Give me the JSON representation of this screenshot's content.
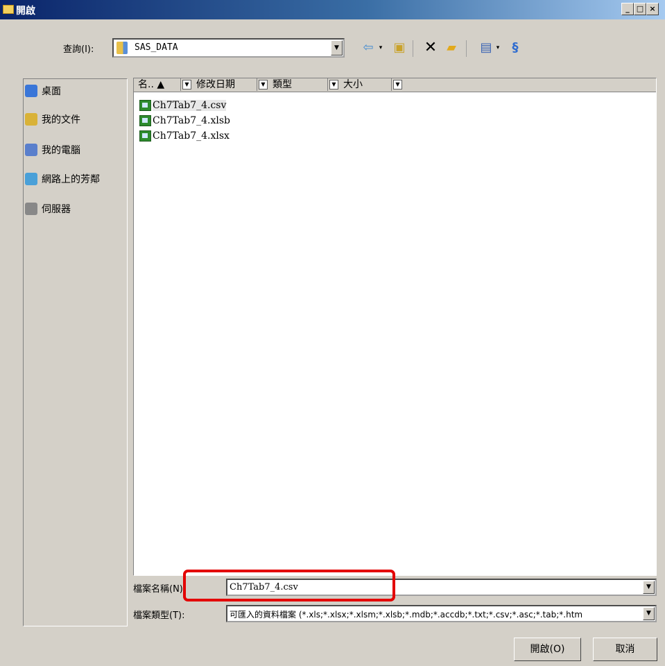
{
  "window": {
    "title": "開啟",
    "buttons": {
      "minimize": "_",
      "maximize": "□",
      "close": "×"
    }
  },
  "lookin": {
    "label": "查詢(I):",
    "value": "SAS_DATA"
  },
  "toolbar": {
    "back_icon": "back-arrow-icon",
    "up_icon": "up-folder-icon",
    "delete_icon": "delete-x-icon",
    "new_folder_icon": "new-folder-icon",
    "views_icon": "views-menu-icon",
    "tools_icon": "tools-icon"
  },
  "places": [
    {
      "label": "桌面",
      "icon": "desktop-icon",
      "color": "#3a76d8"
    },
    {
      "label": "我的文件",
      "icon": "my-documents-icon",
      "color": "#d9b238"
    },
    {
      "label": "我的電腦",
      "icon": "my-computer-icon",
      "color": "#5a7fcc"
    },
    {
      "label": "網路上的芳鄰",
      "icon": "network-icon",
      "color": "#4aa0d8"
    },
    {
      "label": "伺服器",
      "icon": "server-icon",
      "color": "#888888"
    }
  ],
  "columns": [
    {
      "label": "名.. ▲"
    },
    {
      "label": "修改日期"
    },
    {
      "label": "類型"
    },
    {
      "label": "大小"
    }
  ],
  "files": [
    {
      "name": "Ch7Tab7_4.csv",
      "selected": true
    },
    {
      "name": "Ch7Tab7_4.xlsb",
      "selected": false
    },
    {
      "name": "Ch7Tab7_4.xlsx",
      "selected": false
    }
  ],
  "filename": {
    "label": "檔案名稱(N):",
    "value": "Ch7Tab7_4.csv"
  },
  "filetype": {
    "label": "檔案類型(T):",
    "value": "可匯入的資料檔案 (*.xls;*.xlsx;*.xlsm;*.xlsb;*.mdb;*.accdb;*.txt;*.csv;*.asc;*.tab;*.htm"
  },
  "buttons": {
    "open": "開啟(O)",
    "cancel": "取消"
  },
  "colors": {
    "highlight": "#e30000",
    "title_bar": "#0a246a"
  }
}
